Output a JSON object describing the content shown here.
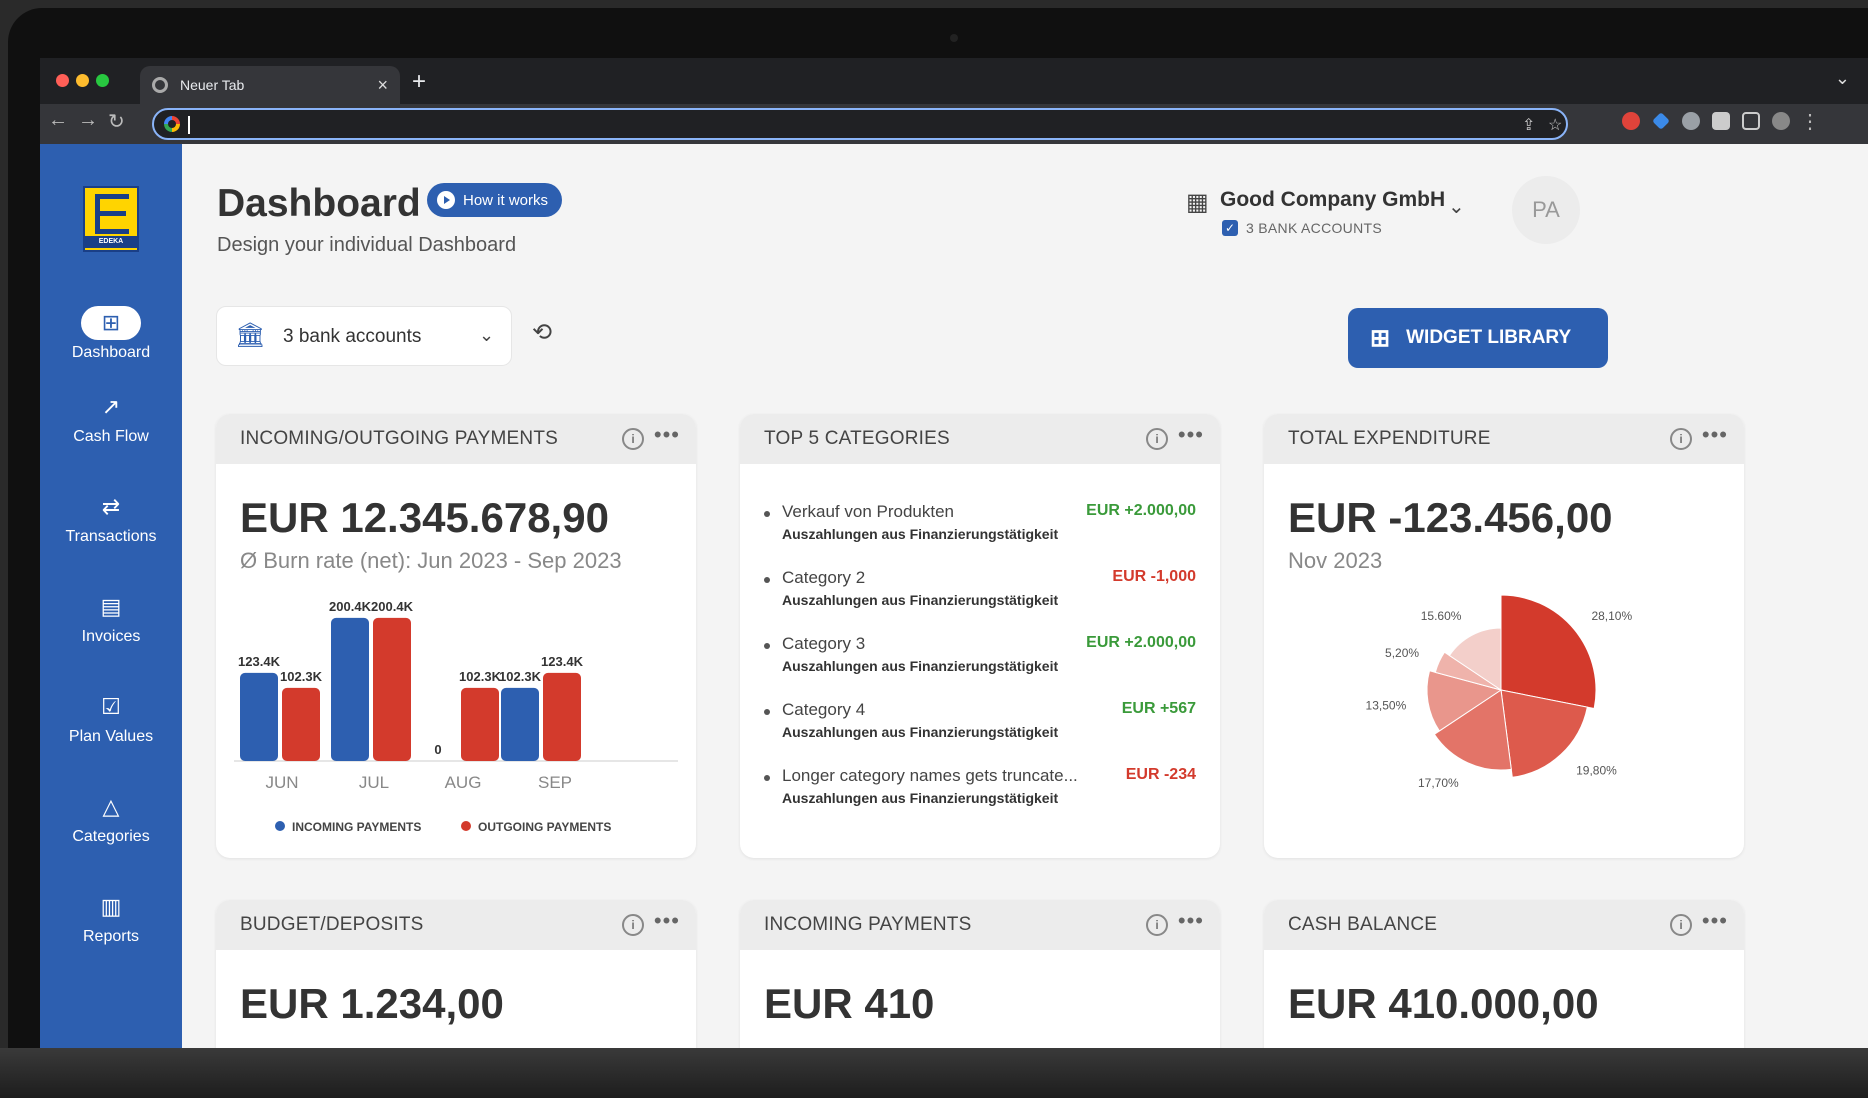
{
  "browser": {
    "tab_title": "Neuer Tab",
    "tab_close": "×",
    "new_tab": "+",
    "address_value": ""
  },
  "sidebar": {
    "brand": "EDEKA",
    "items": [
      {
        "label": "Dashboard",
        "icon": "dashboard-icon",
        "glyph": "⊞",
        "active": true
      },
      {
        "label": "Cash Flow",
        "icon": "trend-icon",
        "glyph": "↗",
        "active": false
      },
      {
        "label": "Transactions",
        "icon": "swap-icon",
        "glyph": "⇄",
        "active": false
      },
      {
        "label": "Invoices",
        "icon": "invoice-icon",
        "glyph": "▤",
        "active": false
      },
      {
        "label": "Plan Values",
        "icon": "checklist-icon",
        "glyph": "☑",
        "active": false
      },
      {
        "label": "Categories",
        "icon": "shapes-icon",
        "glyph": "△",
        "active": false
      },
      {
        "label": "Reports",
        "icon": "chart-icon",
        "glyph": "▥",
        "active": false
      }
    ]
  },
  "header": {
    "title": "Dashboard",
    "how_it_works": "How it works",
    "subtitle": "Design your individual Dashboard",
    "company_name": "Good Company GmbH",
    "bank_accounts_badge": "3 BANK ACCOUNTS",
    "avatar_initials": "PA"
  },
  "controls": {
    "bank_select_value": "3 bank accounts",
    "widget_library": "WIDGET LIBRARY"
  },
  "widgets": {
    "incoming_outgoing": {
      "title": "INCOMING/OUTGOING PAYMENTS",
      "amount": "EUR 12.345.678,90",
      "sub": "Ø Burn rate (net): Jun 2023 - Sep 2023"
    },
    "top_categories": {
      "title": "TOP 5 CATEGORIES",
      "items": [
        {
          "name": "Verkauf von Produkten",
          "sub": "Auszahlungen aus Finanzierungstätigkeit",
          "value": "EUR +2.000,00",
          "color": "#3a9a3a"
        },
        {
          "name": "Category 2",
          "sub": "Auszahlungen aus Finanzierungstätigkeit",
          "value": "EUR -1,000",
          "color": "#d33a2c"
        },
        {
          "name": "Category 3",
          "sub": "Auszahlungen aus Finanzierungstätigkeit",
          "value": "EUR +2.000,00",
          "color": "#3a9a3a"
        },
        {
          "name": "Category 4",
          "sub": "Auszahlungen aus Finanzierungstätigkeit",
          "value": "EUR +567",
          "color": "#3a9a3a"
        },
        {
          "name": "Longer category names gets truncate...",
          "sub": "Auszahlungen aus Finanzierungstätigkeit",
          "value": "EUR -234",
          "color": "#d33a2c"
        }
      ]
    },
    "total_expenditure": {
      "title": "TOTAL EXPENDITURE",
      "amount": "EUR -123.456,00",
      "sub": "Nov 2023"
    },
    "budget_deposits": {
      "title": "BUDGET/DEPOSITS",
      "amount": "EUR 1.234,00"
    },
    "incoming_payments": {
      "title": "INCOMING PAYMENTS",
      "amount": "EUR 410"
    },
    "cash_balance": {
      "title": "CASH BALANCE",
      "amount": "EUR 410.000,00"
    }
  },
  "chart_data": [
    {
      "type": "bar",
      "categories": [
        "JUN",
        "JUL",
        "AUG",
        "SEP"
      ],
      "series": [
        {
          "name": "INCOMING PAYMENTS",
          "values": [
            123.4,
            200.4,
            0,
            102.3
          ],
          "labels": [
            "123.4K",
            "200.4K",
            "0",
            "102.3K"
          ],
          "color": "#2d5fb0"
        },
        {
          "name": "OUTGOING PAYMENTS",
          "values": [
            102.3,
            200.4,
            102.3,
            123.4
          ],
          "labels": [
            "102.3K",
            "200.4K",
            "102.3K",
            "123.4K"
          ],
          "color": "#d33a2c"
        }
      ],
      "ylim": [
        0,
        210
      ],
      "legend": "bottom"
    },
    {
      "type": "pie",
      "values": [
        28.1,
        19.8,
        17.7,
        13.5,
        5.2,
        15.6
      ],
      "labels": [
        "28,10%",
        "19,80%",
        "17,70%",
        "13,50%",
        "5,20%",
        "15.60%"
      ],
      "colors": [
        "#d33a2c",
        "#dd5a4c",
        "#e37468",
        "#e9968c",
        "#efb3ab",
        "#f3cfca"
      ]
    }
  ]
}
